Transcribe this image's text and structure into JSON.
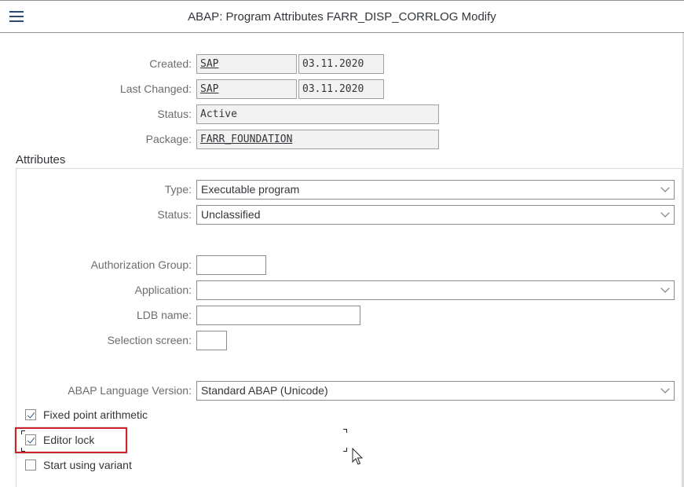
{
  "header": {
    "title": "ABAP: Program Attributes FARR_DISP_CORRLOG Modify",
    "menu_icon": "hamburger-menu-icon"
  },
  "general": {
    "created_label": "Created:",
    "created_by": "SAP",
    "created_on": "03.11.2020",
    "last_changed_label": "Last Changed:",
    "last_changed_by": "SAP",
    "last_changed_on": "03.11.2020",
    "status_label": "Status:",
    "status_value": "Active",
    "package_label": "Package:",
    "package_value": "FARR_FOUNDATION"
  },
  "attributes": {
    "section_title": "Attributes",
    "type_label": "Type:",
    "type_value": "Executable program",
    "status_label": "Status:",
    "status_value": "Unclassified",
    "auth_group_label": "Authorization Group:",
    "auth_group_value": "",
    "application_label": "Application:",
    "application_value": "",
    "ldb_label": "LDB name:",
    "ldb_value": "",
    "selection_screen_label": "Selection screen:",
    "selection_screen_value": "",
    "language_version_label": "ABAP Language Version:",
    "language_version_value": "Standard ABAP (Unicode)",
    "checkboxes": [
      {
        "label": "Fixed point arithmetic",
        "checked": true
      },
      {
        "label": "Editor lock",
        "checked": true
      },
      {
        "label": "Start using variant",
        "checked": false
      }
    ]
  },
  "annotation": {
    "highlight_color": "#d0202a",
    "highlighted_item": "Editor lock"
  }
}
